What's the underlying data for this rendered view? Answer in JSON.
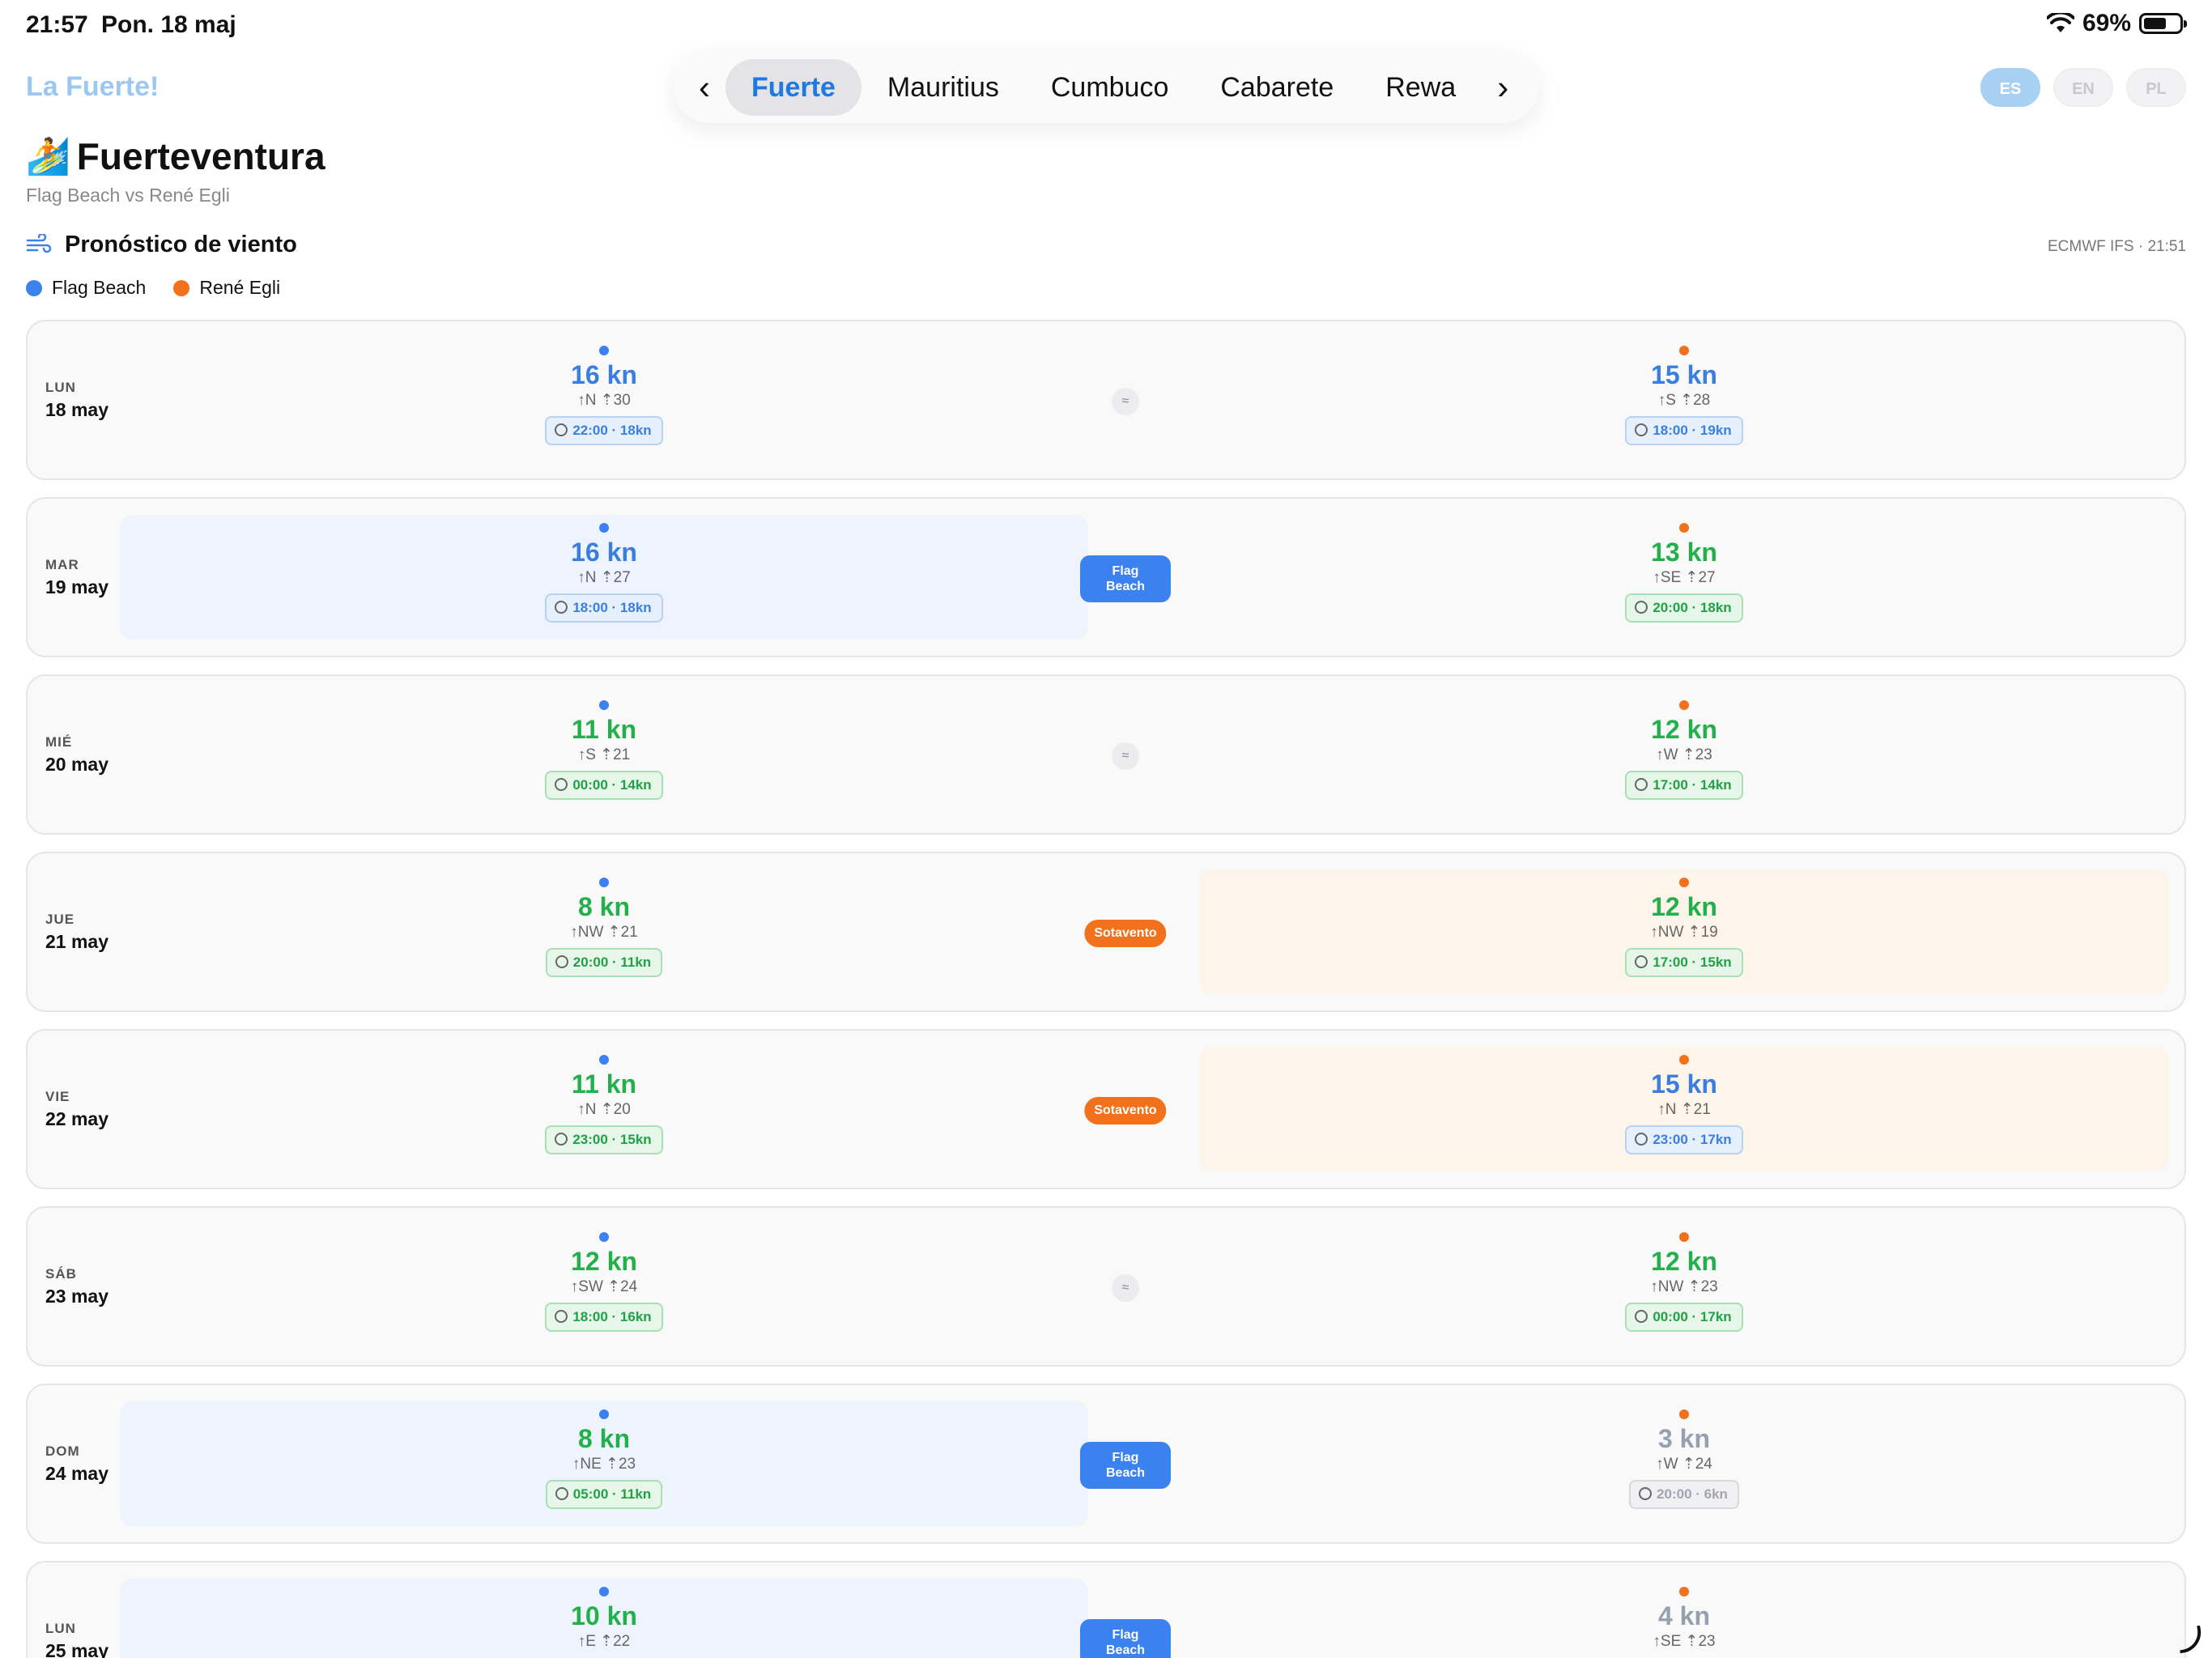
{
  "status_bar": {
    "time": "21:57",
    "date": "Pon. 18 maj",
    "battery": "69%"
  },
  "header": {
    "brand": "La Fuerte!",
    "tabs": [
      {
        "label": "Fuerte",
        "active": true
      },
      {
        "label": "Mauritius",
        "active": false
      },
      {
        "label": "Cumbuco",
        "active": false
      },
      {
        "label": "Cabarete",
        "active": false
      },
      {
        "label": "Rewa",
        "active": false
      }
    ],
    "languages": [
      {
        "label": "ES",
        "active": true
      },
      {
        "label": "EN",
        "active": false
      },
      {
        "label": "PL",
        "active": false
      }
    ]
  },
  "page": {
    "emoji": "🏄",
    "title": "Fuerteventura",
    "subtitle": "Flag Beach vs René Egli"
  },
  "forecast": {
    "section_title": "Pronóstico de viento",
    "model": "ECMWF IFS · 21:51",
    "legend": [
      {
        "name": "Flag Beach",
        "color": "#3b82f0"
      },
      {
        "name": "René Egli",
        "color": "#f2711c"
      }
    ],
    "days": [
      {
        "day": "LUN",
        "date": "18 may",
        "winner": "none",
        "badge": "≈",
        "a": {
          "speed": "16 kn",
          "dir": "↑N ⇡30",
          "gust": "22:00 · 18kn",
          "tone": "blue"
        },
        "b": {
          "speed": "15 kn",
          "dir": "↑S ⇡28",
          "gust": "18:00 · 19kn",
          "tone": "blue"
        }
      },
      {
        "day": "MAR",
        "date": "19 may",
        "winner": "a",
        "badge": "Flag Beach",
        "a": {
          "speed": "16 kn",
          "dir": "↑N ⇡27",
          "gust": "18:00 · 18kn",
          "tone": "blue"
        },
        "b": {
          "speed": "13 kn",
          "dir": "↑SE ⇡27",
          "gust": "20:00 · 18kn",
          "tone": "green"
        }
      },
      {
        "day": "MIÉ",
        "date": "20 may",
        "winner": "none",
        "badge": "≈",
        "a": {
          "speed": "11 kn",
          "dir": "↑S ⇡21",
          "gust": "00:00 · 14kn",
          "tone": "green"
        },
        "b": {
          "speed": "12 kn",
          "dir": "↑W ⇡23",
          "gust": "17:00 · 14kn",
          "tone": "green"
        }
      },
      {
        "day": "JUE",
        "date": "21 may",
        "winner": "b",
        "badge": "Sotavento",
        "a": {
          "speed": "8 kn",
          "dir": "↑NW ⇡21",
          "gust": "20:00 · 11kn",
          "tone": "green"
        },
        "b": {
          "speed": "12 kn",
          "dir": "↑NW ⇡19",
          "gust": "17:00 · 15kn",
          "tone": "green"
        }
      },
      {
        "day": "VIE",
        "date": "22 may",
        "winner": "b",
        "badge": "Sotavento",
        "a": {
          "speed": "11 kn",
          "dir": "↑N ⇡20",
          "gust": "23:00 · 15kn",
          "tone": "green"
        },
        "b": {
          "speed": "15 kn",
          "dir": "↑N ⇡21",
          "gust": "23:00 · 17kn",
          "tone": "blue"
        }
      },
      {
        "day": "SÁB",
        "date": "23 may",
        "winner": "none",
        "badge": "≈",
        "a": {
          "speed": "12 kn",
          "dir": "↑SW ⇡24",
          "gust": "18:00 · 16kn",
          "tone": "green"
        },
        "b": {
          "speed": "12 kn",
          "dir": "↑NW ⇡23",
          "gust": "00:00 · 17kn",
          "tone": "green"
        }
      },
      {
        "day": "DOM",
        "date": "24 may",
        "winner": "a",
        "badge": "Flag Beach",
        "a": {
          "speed": "8 kn",
          "dir": "↑NE ⇡23",
          "gust": "05:00 · 11kn",
          "tone": "green"
        },
        "b": {
          "speed": "3 kn",
          "dir": "↑W ⇡24",
          "gust": "20:00 · 6kn",
          "tone": "grey"
        }
      },
      {
        "day": "LUN",
        "date": "25 may",
        "winner": "a",
        "badge": "Flag Beach",
        "a": {
          "speed": "10 kn",
          "dir": "↑E ⇡22",
          "gust": "",
          "tone": "green"
        },
        "b": {
          "speed": "4 kn",
          "dir": "↑SE ⇡23",
          "gust": "",
          "tone": "grey"
        }
      }
    ]
  }
}
